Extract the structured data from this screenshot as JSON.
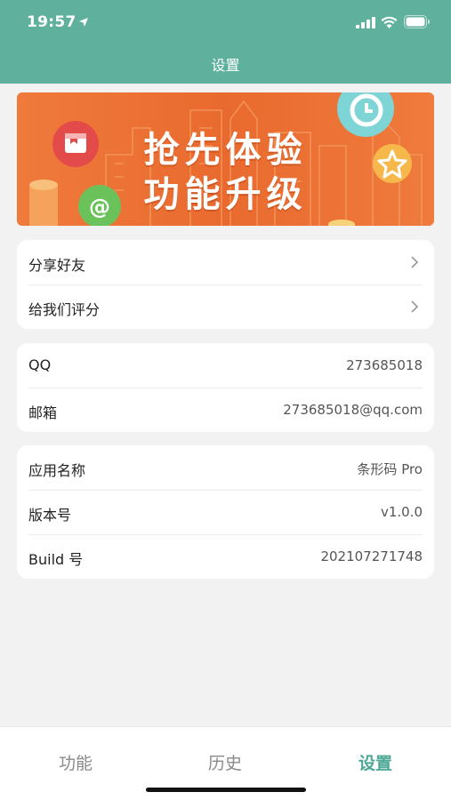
{
  "status_bar": {
    "time": "19:57",
    "icons": [
      "location-arrow-icon",
      "signal-icon",
      "wifi-icon",
      "battery-icon"
    ]
  },
  "nav": {
    "title": "设置"
  },
  "banner": {
    "line1": "抢先体验",
    "line2": "功能升级",
    "icons": [
      "clock-icon",
      "calendar-icon",
      "star-icon",
      "at-icon"
    ]
  },
  "share_card": {
    "items": [
      {
        "label": "分享好友"
      },
      {
        "label": "给我们评分"
      }
    ]
  },
  "contact_card": {
    "items": [
      {
        "label": "QQ",
        "value": "273685018"
      },
      {
        "label": "邮箱",
        "value": "273685018@qq.com"
      }
    ]
  },
  "app_card": {
    "items": [
      {
        "label": "应用名称",
        "value": "条形码 Pro"
      },
      {
        "label": "版本号",
        "value": "v1.0.0"
      },
      {
        "label": "Build 号",
        "value": "202107271748"
      }
    ]
  },
  "tabbar": {
    "tabs": [
      {
        "label": "功能"
      },
      {
        "label": "历史"
      },
      {
        "label": "设置"
      }
    ],
    "active_index": 2
  },
  "colors": {
    "header": "#5fb09d",
    "accent": "#4ea896",
    "banner": "#ea6d30"
  }
}
